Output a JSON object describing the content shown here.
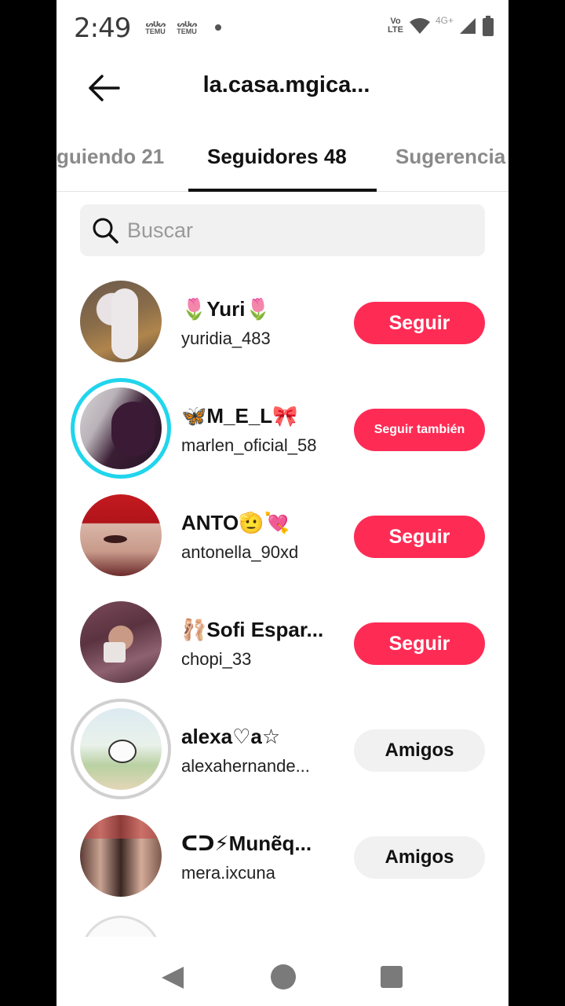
{
  "status_bar": {
    "time": "2:49",
    "notifications": [
      "TEMU",
      "TEMU"
    ],
    "volte": "Vo LTE",
    "network": "4G+",
    "icons": [
      "wifi-icon",
      "signal-icon",
      "battery-icon"
    ]
  },
  "header": {
    "title": "la.casa.mgica...",
    "back_icon": "arrow-left-icon"
  },
  "tabs": [
    {
      "label": "guiendo 21",
      "active": false
    },
    {
      "label": "Seguidores 48",
      "active": true
    },
    {
      "label": "Sugerencia",
      "active": false
    }
  ],
  "search": {
    "placeholder": "Buscar",
    "value": ""
  },
  "followers": [
    {
      "name": "🌷Yuri🌷",
      "handle": "yuridia_483",
      "button": "Seguir",
      "button_type": "follow"
    },
    {
      "name": "🦋M_E_L🎀",
      "handle": "marlen_oficial_58",
      "button": "Seguir también",
      "button_type": "follow"
    },
    {
      "name": "ANTO🫡💘",
      "handle": "antonella_90xd",
      "button": "Seguir",
      "button_type": "follow"
    },
    {
      "name": "🩰Sofi Espar...",
      "handle": "chopi_33",
      "button": "Seguir",
      "button_type": "follow"
    },
    {
      "name": "alexa♡a☆",
      "handle": "alexahernande...",
      "button": "Amigos",
      "button_type": "friends"
    },
    {
      "name": "ᑕᑐ⚡Munẽq...",
      "handle": "mera.ixcuna",
      "button": "Amigos",
      "button_type": "friends"
    }
  ],
  "colors": {
    "accent": "#fe2c55",
    "story_ring": "#20d5ec",
    "text": "#111111",
    "muted": "#8a8a8a"
  }
}
